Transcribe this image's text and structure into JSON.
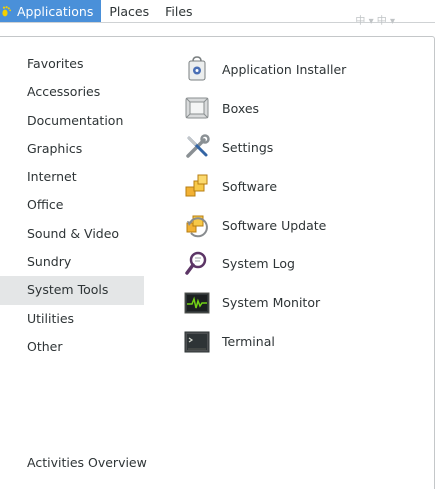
{
  "topbar": {
    "menus": [
      {
        "label": "Applications",
        "active": true
      },
      {
        "label": "Places"
      },
      {
        "label": "Files"
      }
    ],
    "tray_text": "中 ▾ 中 ▾"
  },
  "categories": [
    {
      "label": "Favorites"
    },
    {
      "label": "Accessories"
    },
    {
      "label": "Documentation"
    },
    {
      "label": "Graphics"
    },
    {
      "label": "Internet"
    },
    {
      "label": "Office"
    },
    {
      "label": "Sound & Video"
    },
    {
      "label": "Sundry"
    },
    {
      "label": "System Tools",
      "selected": true
    },
    {
      "label": "Utilities"
    },
    {
      "label": "Other"
    }
  ],
  "activities_label": "Activities Overview",
  "apps": [
    {
      "label": "Application Installer",
      "icon": "application-installer-icon"
    },
    {
      "label": "Boxes",
      "icon": "boxes-icon"
    },
    {
      "label": "Settings",
      "icon": "settings-icon"
    },
    {
      "label": "Software",
      "icon": "software-icon"
    },
    {
      "label": "Software Update",
      "icon": "software-update-icon"
    },
    {
      "label": "System Log",
      "icon": "system-log-icon"
    },
    {
      "label": "System Monitor",
      "icon": "system-monitor-icon"
    },
    {
      "label": "Terminal",
      "icon": "terminal-icon"
    }
  ],
  "colors": {
    "accent": "#4a90d9",
    "selected_bg": "#e4e6e7",
    "text": "#2e3436"
  }
}
